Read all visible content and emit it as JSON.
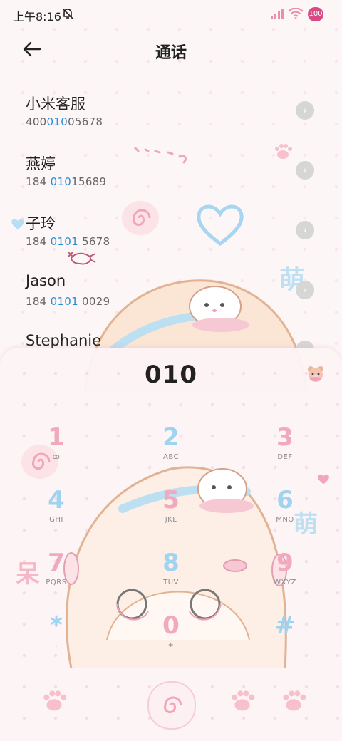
{
  "status_bar": {
    "time": "上午8:16",
    "battery": "100"
  },
  "header": {
    "title": "通话"
  },
  "contacts": [
    {
      "name": "小米客服",
      "num_pre": "400",
      "num_hl": "010",
      "num_post": "05678"
    },
    {
      "name": "燕婷",
      "num_pre": "184 ",
      "num_hl": "010",
      "num_post": "15689"
    },
    {
      "name": "子玲",
      "num_pre": "184 ",
      "num_hl": "0101",
      "num_post": " 5678"
    },
    {
      "name": "Jason",
      "num_pre": "184 ",
      "num_hl": "0101",
      "num_post": " 0029"
    },
    {
      "name": "Stephanie",
      "num_pre": "",
      "num_hl": "",
      "num_post": ""
    }
  ],
  "dialer": {
    "number": "010",
    "keys": [
      {
        "digit": "1",
        "letters": "ꝏ"
      },
      {
        "digit": "2",
        "letters": "ABC"
      },
      {
        "digit": "3",
        "letters": "DEF"
      },
      {
        "digit": "4",
        "letters": "GHI"
      },
      {
        "digit": "5",
        "letters": "JKL"
      },
      {
        "digit": "6",
        "letters": "MNO"
      },
      {
        "digit": "7",
        "letters": "PQRS"
      },
      {
        "digit": "8",
        "letters": "TUV"
      },
      {
        "digit": "9",
        "letters": "WXYZ"
      },
      {
        "digit": "*",
        "letters": ","
      },
      {
        "digit": "0",
        "letters": "+"
      },
      {
        "digit": "#",
        "letters": ""
      }
    ]
  },
  "colors": {
    "highlight": "#2a8ed3",
    "key_pink": "#f1a9bd",
    "key_blue": "#9fd3f0",
    "battery": "#d94a84"
  },
  "decorations": {
    "meng_char": "萌",
    "flower_char": "呆"
  }
}
